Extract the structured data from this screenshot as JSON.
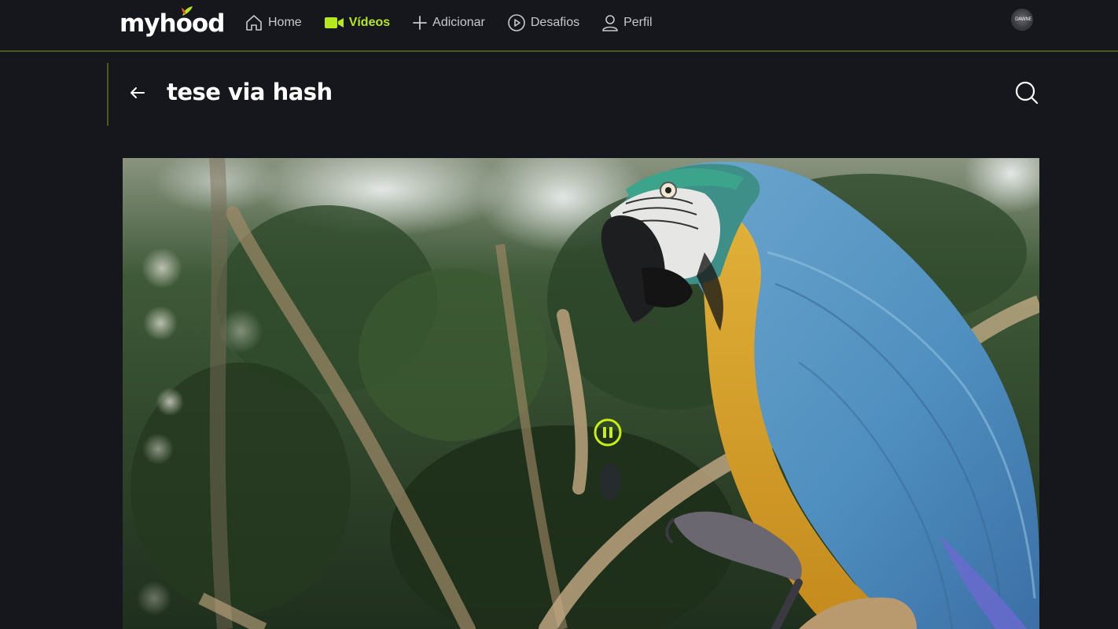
{
  "brand": {
    "logo_text_prefix": "myh",
    "logo_text_o": "o",
    "logo_text_suffix": "od",
    "accent_color": "#b7e81b"
  },
  "nav": {
    "items": [
      {
        "label": "Home",
        "icon": "home-icon",
        "active": false
      },
      {
        "label": "Vídeos",
        "icon": "video-camera-icon",
        "active": true
      },
      {
        "label": "Adicionar",
        "icon": "plus-icon",
        "active": false
      },
      {
        "label": "Desafios",
        "icon": "play-circle-icon",
        "active": false
      },
      {
        "label": "Perfil",
        "icon": "user-icon",
        "active": false
      }
    ]
  },
  "user": {
    "avatar_text": "DAWNE"
  },
  "header": {
    "title": "tese via hash",
    "back_icon": "arrow-left-icon",
    "search_icon": "search-icon"
  },
  "video": {
    "content": "blue-and-yellow macaw perched on a branch",
    "state": "playing",
    "control_icon": "pause-icon"
  }
}
